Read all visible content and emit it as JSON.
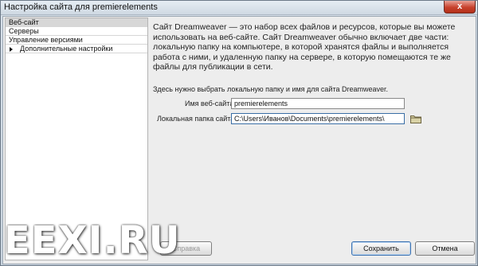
{
  "window": {
    "title": "Настройка сайта для premierelements",
    "close_label": "x"
  },
  "sidebar": {
    "items": [
      {
        "label": "Веб-сайт",
        "selected": true,
        "has_arrow": false
      },
      {
        "label": "Серверы",
        "selected": false,
        "has_arrow": false
      },
      {
        "label": "Управление версиями",
        "selected": false,
        "has_arrow": false
      },
      {
        "label": "Дополнительные настройки",
        "selected": false,
        "has_arrow": true
      }
    ]
  },
  "main": {
    "description": "Сайт Dreamweaver — это набор всех файлов и ресурсов, которые вы можете использовать на веб-сайте. Сайт Dreamweaver обычно включает две части: локальную папку на компьютере, в которой хранятся файлы и выполняется работа с ними, и удаленную папку на сервере, в которую помещаются те же файлы для публикации в сети.",
    "hint": "Здесь нужно выбрать локальную папку и имя для сайта Dreamweaver.",
    "site_name_label": "Имя веб-сайта:",
    "site_name_value": "premierelements",
    "local_folder_label": "Локальная папка сайта:",
    "local_folder_value": "C:\\Users\\Иванов\\Documents\\premierelements\\",
    "folder_icon": "folder-browse-icon"
  },
  "footer": {
    "help_label": "Справка",
    "save_label": "Сохранить",
    "cancel_label": "Отмена"
  },
  "watermark": {
    "text": "EEXI.RU"
  }
}
